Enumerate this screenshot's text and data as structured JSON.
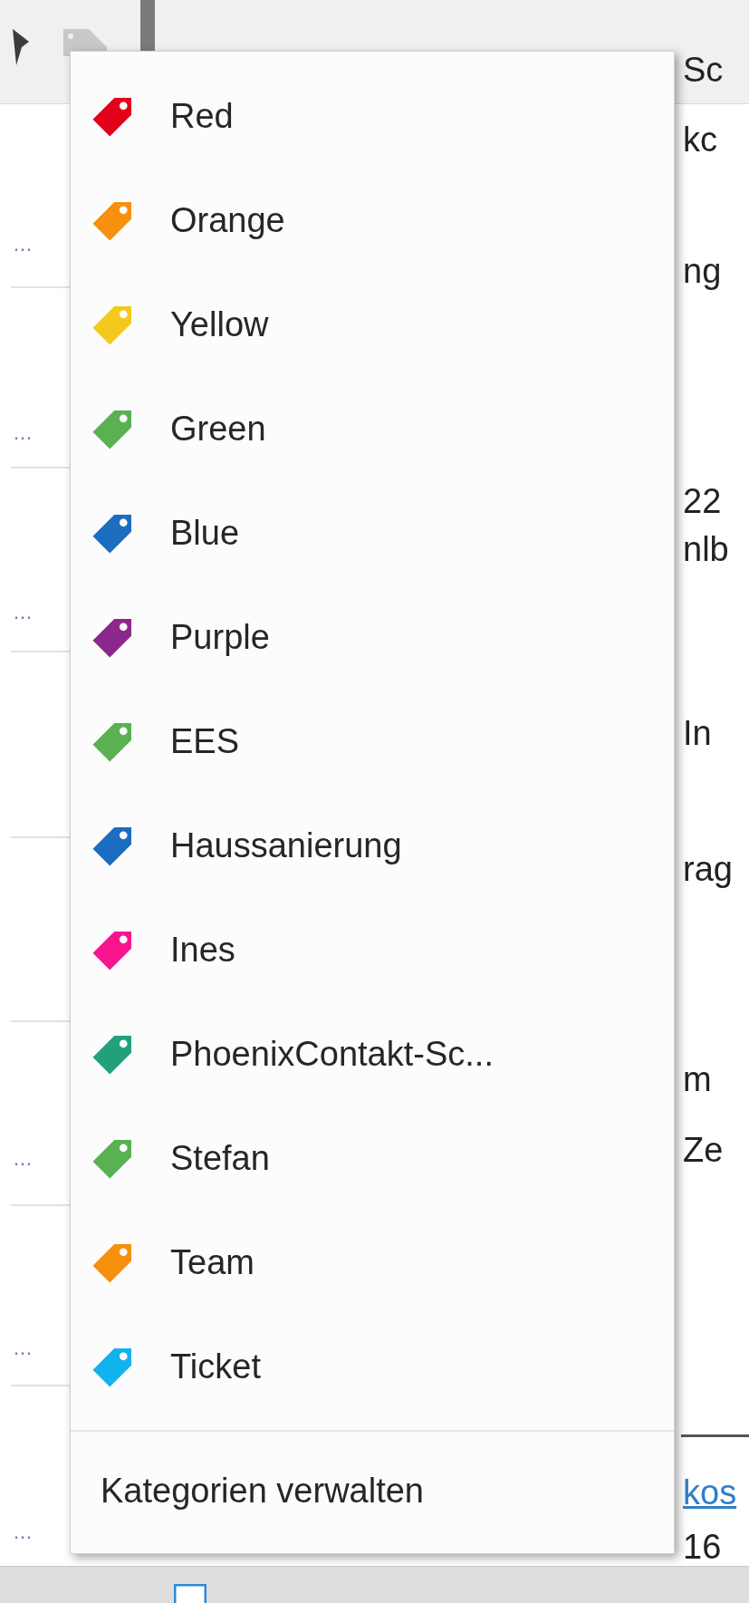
{
  "background": {
    "left_fragments": [
      "…",
      "…",
      "…",
      "…",
      "…",
      "…"
    ],
    "right_fragments": [
      {
        "text": "Sc",
        "kind": "text"
      },
      {
        "text": "kc",
        "kind": "text"
      },
      {
        "text": "ng",
        "kind": "text"
      },
      {
        "text": "22",
        "kind": "text"
      },
      {
        "text": "nlb",
        "kind": "text"
      },
      {
        "text": "In",
        "kind": "text"
      },
      {
        "text": "rag",
        "kind": "text"
      },
      {
        "text": "m",
        "kind": "text"
      },
      {
        "text": "Ze",
        "kind": "text"
      },
      {
        "text": "kos",
        "kind": "link"
      },
      {
        "text": "16",
        "kind": "text"
      }
    ]
  },
  "category_menu": {
    "items": [
      {
        "label": "Red",
        "color": "#e3001b"
      },
      {
        "label": "Orange",
        "color": "#f7900e"
      },
      {
        "label": "Yellow",
        "color": "#f4c81c"
      },
      {
        "label": "Green",
        "color": "#5ab152"
      },
      {
        "label": "Blue",
        "color": "#1c6dbf"
      },
      {
        "label": "Purple",
        "color": "#8c288c"
      },
      {
        "label": "EES",
        "color": "#5ab152"
      },
      {
        "label": "Haussanierung",
        "color": "#1c6dbf"
      },
      {
        "label": "Ines",
        "color": "#f7158f"
      },
      {
        "label": "PhoenixContakt-Sc...",
        "color": "#21a07e"
      },
      {
        "label": "Stefan",
        "color": "#5ab152"
      },
      {
        "label": "Team",
        "color": "#f7900e"
      },
      {
        "label": "Ticket",
        "color": "#12b2ef"
      }
    ],
    "footer": "Kategorien verwalten"
  }
}
